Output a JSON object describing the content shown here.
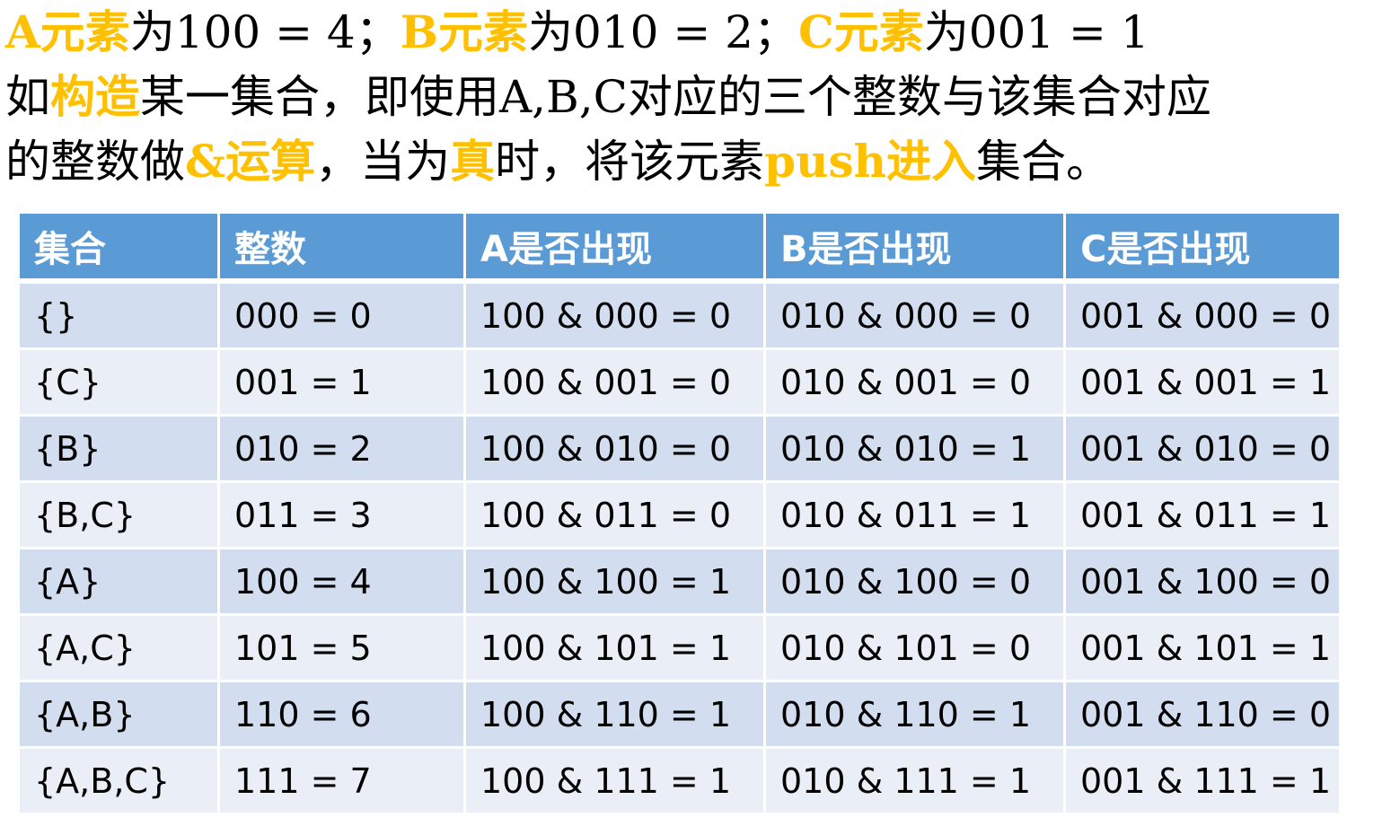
{
  "intro": {
    "line1": [
      {
        "text": "A元素",
        "highlight": true
      },
      {
        "text": "为100 = 4；",
        "highlight": false
      },
      {
        "text": "B元素",
        "highlight": true
      },
      {
        "text": "为010 = 2；",
        "highlight": false
      },
      {
        "text": "C元素",
        "highlight": true
      },
      {
        "text": "为001 = 1",
        "highlight": false
      }
    ],
    "line2": [
      {
        "text": "如",
        "highlight": false
      },
      {
        "text": "构造",
        "highlight": true
      },
      {
        "text": "某一集合，即使用A,B,C对应的三个整数与该集合对应",
        "highlight": false
      }
    ],
    "line3": [
      {
        "text": "的整数做",
        "highlight": false
      },
      {
        "text": "&运算",
        "highlight": true
      },
      {
        "text": "，当为",
        "highlight": false
      },
      {
        "text": "真",
        "highlight": true
      },
      {
        "text": "时，将该元素",
        "highlight": false
      },
      {
        "text": "push进入",
        "highlight": true
      },
      {
        "text": "集合。",
        "highlight": false
      }
    ]
  },
  "table": {
    "headers": [
      "集合",
      "整数",
      "A是否出现",
      "B是否出现",
      "C是否出现"
    ],
    "rows": [
      [
        "{}",
        "000 = 0",
        "100 & 000 = 0",
        "010 & 000 = 0",
        "001 & 000 = 0"
      ],
      [
        "{C}",
        "001 = 1",
        "100 & 001 = 0",
        "010 & 001 = 0",
        "001 & 001 = 1"
      ],
      [
        "{B}",
        "010 = 2",
        "100 & 010 = 0",
        "010 & 010 = 1",
        "001 & 010 = 0"
      ],
      [
        "{B,C}",
        "011 = 3",
        "100 & 011 = 0",
        "010 & 011 = 1",
        "001 & 011 = 1"
      ],
      [
        "{A}",
        "100 = 4",
        "100 & 100 = 1",
        "010 & 100 = 0",
        "001 & 100 = 0"
      ],
      [
        "{A,C}",
        "101 = 5",
        "100 & 101 = 1",
        "010 & 101 = 0",
        "001 & 101 = 1"
      ],
      [
        "{A,B}",
        "110 = 6",
        "100 & 110 = 1",
        "010 & 110 = 1",
        "001 & 110 = 0"
      ],
      [
        "{A,B,C}",
        "111 = 7",
        "100 & 111 = 1",
        "010 & 111 = 1",
        "001 & 111 = 1"
      ]
    ]
  },
  "colors": {
    "highlight": "#FFC000",
    "header_bg": "#5B9BD5",
    "row_dark": "#D2DEEF",
    "row_light": "#EAEFF7"
  }
}
